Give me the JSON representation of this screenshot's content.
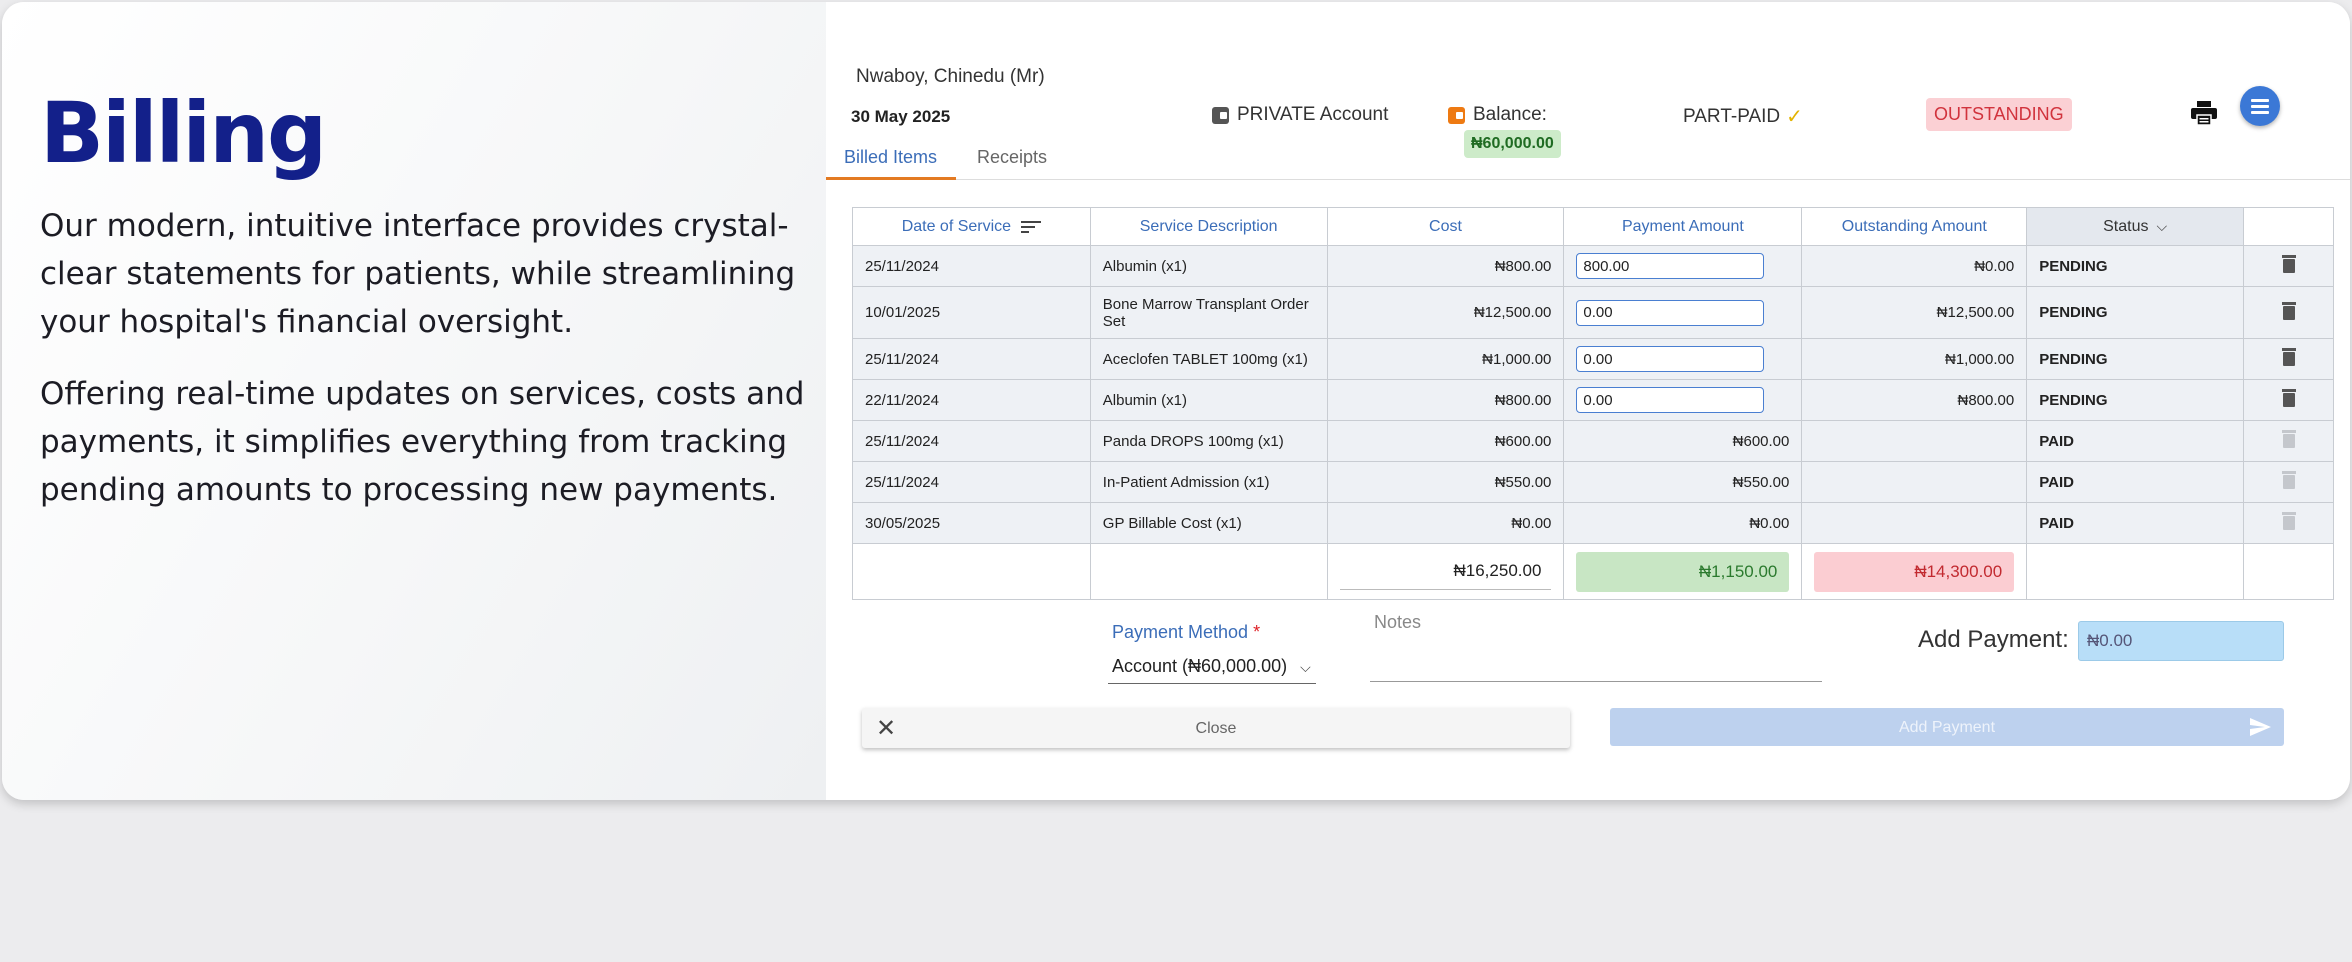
{
  "marketing": {
    "title": "Billing",
    "paragraph1": "Our modern, intuitive interface provides crystal-clear statements for patients, while streamlining your hospital's financial oversight.",
    "paragraph2": "Offering real-time updates on services, costs and payments, it simplifies everything from tracking pending amounts to processing new payments."
  },
  "header": {
    "patient_name": "Nwaboy, Chinedu (Mr)",
    "date": "30 May 2025",
    "account_type": "PRIVATE Account",
    "balance_label": "Balance:",
    "balance_value": "₦60,000.00",
    "payment_status": "PART-PAID",
    "outstanding_badge": "OUTSTANDING"
  },
  "tabs": [
    {
      "label": "Billed Items",
      "active": true
    },
    {
      "label": "Receipts",
      "active": false
    }
  ],
  "table": {
    "columns": [
      "Date of Service",
      "Service Description",
      "Cost",
      "Payment Amount",
      "Outstanding Amount",
      "Status"
    ],
    "rows": [
      {
        "date": "25/11/2024",
        "description": "Albumin (x1)",
        "cost": "₦800.00",
        "payment": "800.00",
        "payment_editable": true,
        "outstanding": "₦0.00",
        "outstanding_color": "green",
        "status": "PENDING"
      },
      {
        "date": "10/01/2025",
        "description": "Bone Marrow Transplant Order Set",
        "cost": "₦12,500.00",
        "payment": "0.00",
        "payment_editable": true,
        "outstanding": "₦12,500.00",
        "outstanding_color": "red",
        "status": "PENDING"
      },
      {
        "date": "25/11/2024",
        "description": "Aceclofen TABLET 100mg (x1)",
        "cost": "₦1,000.00",
        "payment": "0.00",
        "payment_editable": true,
        "outstanding": "₦1,000.00",
        "outstanding_color": "red",
        "status": "PENDING"
      },
      {
        "date": "22/11/2024",
        "description": "Albumin (x1)",
        "cost": "₦800.00",
        "payment": "0.00",
        "payment_editable": true,
        "outstanding": "₦800.00",
        "outstanding_color": "red",
        "status": "PENDING"
      },
      {
        "date": "25/11/2024",
        "description": "Panda DROPS 100mg (x1)",
        "cost": "₦600.00",
        "payment": "₦600.00",
        "payment_editable": false,
        "outstanding": "",
        "outstanding_color": "",
        "status": "PAID"
      },
      {
        "date": "25/11/2024",
        "description": "In-Patient Admission (x1)",
        "cost": "₦550.00",
        "payment": "₦550.00",
        "payment_editable": false,
        "outstanding": "",
        "outstanding_color": "",
        "status": "PAID"
      },
      {
        "date": "30/05/2025",
        "description": "GP Billable Cost (x1)",
        "cost": "₦0.00",
        "payment": "₦0.00",
        "payment_editable": false,
        "outstanding": "",
        "outstanding_color": "",
        "status": "PAID"
      }
    ],
    "totals": {
      "cost": "₦16,250.00",
      "payment": "₦1,150.00",
      "outstanding": "₦14,300.00"
    }
  },
  "form": {
    "payment_method_label": "Payment Method",
    "required_mark": "*",
    "payment_method_value": "Account (₦60,000.00)",
    "notes_placeholder": "Notes",
    "add_payment_label": "Add Payment:",
    "add_payment_value": "₦0.00",
    "close_label": "Close",
    "add_payment_button_label": "Add Payment"
  },
  "colors": {
    "brand": "#13208a",
    "link_blue": "#3b6db8",
    "tab_accent": "#e37a22",
    "paid_green": "#23a323",
    "pending_red": "#de1f25",
    "menu_button": "#3b78d6"
  }
}
